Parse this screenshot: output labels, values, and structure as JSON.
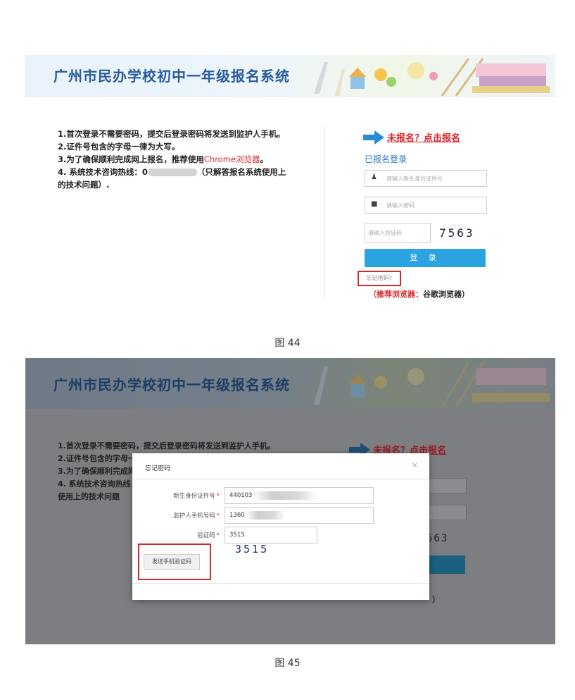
{
  "figure1": {
    "banner_title": "广州市民办学校初中一年级报名系统",
    "notes": {
      "l1": "1.首次登录不需要密码，提交后登录密码将发送到监护人手机。",
      "l2": "2.证件号包含的字母一律为大写。",
      "l3a": "3.为了确保顺利完成网上报名，推荐使用",
      "l3b": "Chrome浏览器",
      "l3c": "。",
      "l4a": "4. 系统技术咨询热线：0",
      "l4b": "（只解答报名系统使用上的技术问题）."
    },
    "login": {
      "register_link": "未报名？点击报名",
      "subtitle": "已报名登录",
      "id_placeholder": "请输入新生身份证件号",
      "password_placeholder": "请输入密码",
      "captcha_placeholder": "请输入验证码",
      "captcha_code": "7563",
      "login_button": "登 录",
      "forgot_link": "忘记密码?",
      "recommend_label": "（推荐浏览器：",
      "recommend_value": "谷歌浏览器）"
    },
    "caption": "图 44"
  },
  "figure2": {
    "banner_title": "广州市民办学校初中一年级报名系统",
    "notes": {
      "l1": "1.首次登录不需要密码，提交后登录密码将发送到监护人手机。",
      "l2": "2.证件号包含的字母一",
      "l3": "3.为了确保顺利完成网",
      "l4": "4. 系统技术咨询热线：",
      "l5": "使用上的技术问题"
    },
    "register_link": "未报名？点击报名",
    "bg_captcha": "563",
    "bg_recommend_tail": "）",
    "modal": {
      "title": "忘记密码",
      "close": "×",
      "id_label": "新生身份证件号",
      "id_value": "440103",
      "phone_label": "监护人手机号码",
      "phone_value": "1360",
      "captcha_label": "验证码",
      "captcha_value": "3515",
      "captcha_image": "3515",
      "required_mark": "*",
      "send_button": "发送手机验证码"
    },
    "caption": "图 45"
  },
  "colors": {
    "title_blue": "#2a5d9c",
    "accent_red": "#d9262c",
    "login_button": "#2aa3e0",
    "overlay_gray": "#7c7e82"
  }
}
